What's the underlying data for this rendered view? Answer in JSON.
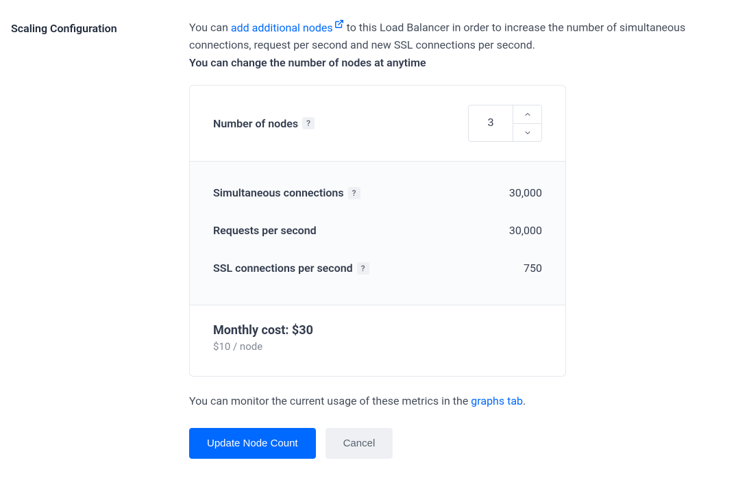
{
  "section_title": "Scaling Configuration",
  "intro": {
    "prefix": "You can ",
    "link_text": "add additional nodes",
    "suffix": " to this Load Balancer in order to increase the number of simultaneous connections, request per second and new SSL connections per second.",
    "bold_line": "You can change the number of nodes at anytime"
  },
  "nodes": {
    "label": "Number of nodes",
    "value": "3"
  },
  "metrics": {
    "sim_conn_label": "Simultaneous connections",
    "sim_conn_value": "30,000",
    "rps_label": "Requests per second",
    "rps_value": "30,000",
    "ssl_label": "SSL connections per second",
    "ssl_value": "750"
  },
  "cost": {
    "label": "Monthly cost:",
    "amount": "$30",
    "per_node": "$10 / node"
  },
  "footer": {
    "prefix": "You can monitor the current usage of these metrics in the ",
    "link": "graphs tab",
    "suffix": "."
  },
  "buttons": {
    "update": "Update Node Count",
    "cancel": "Cancel"
  },
  "help_icon": "?"
}
